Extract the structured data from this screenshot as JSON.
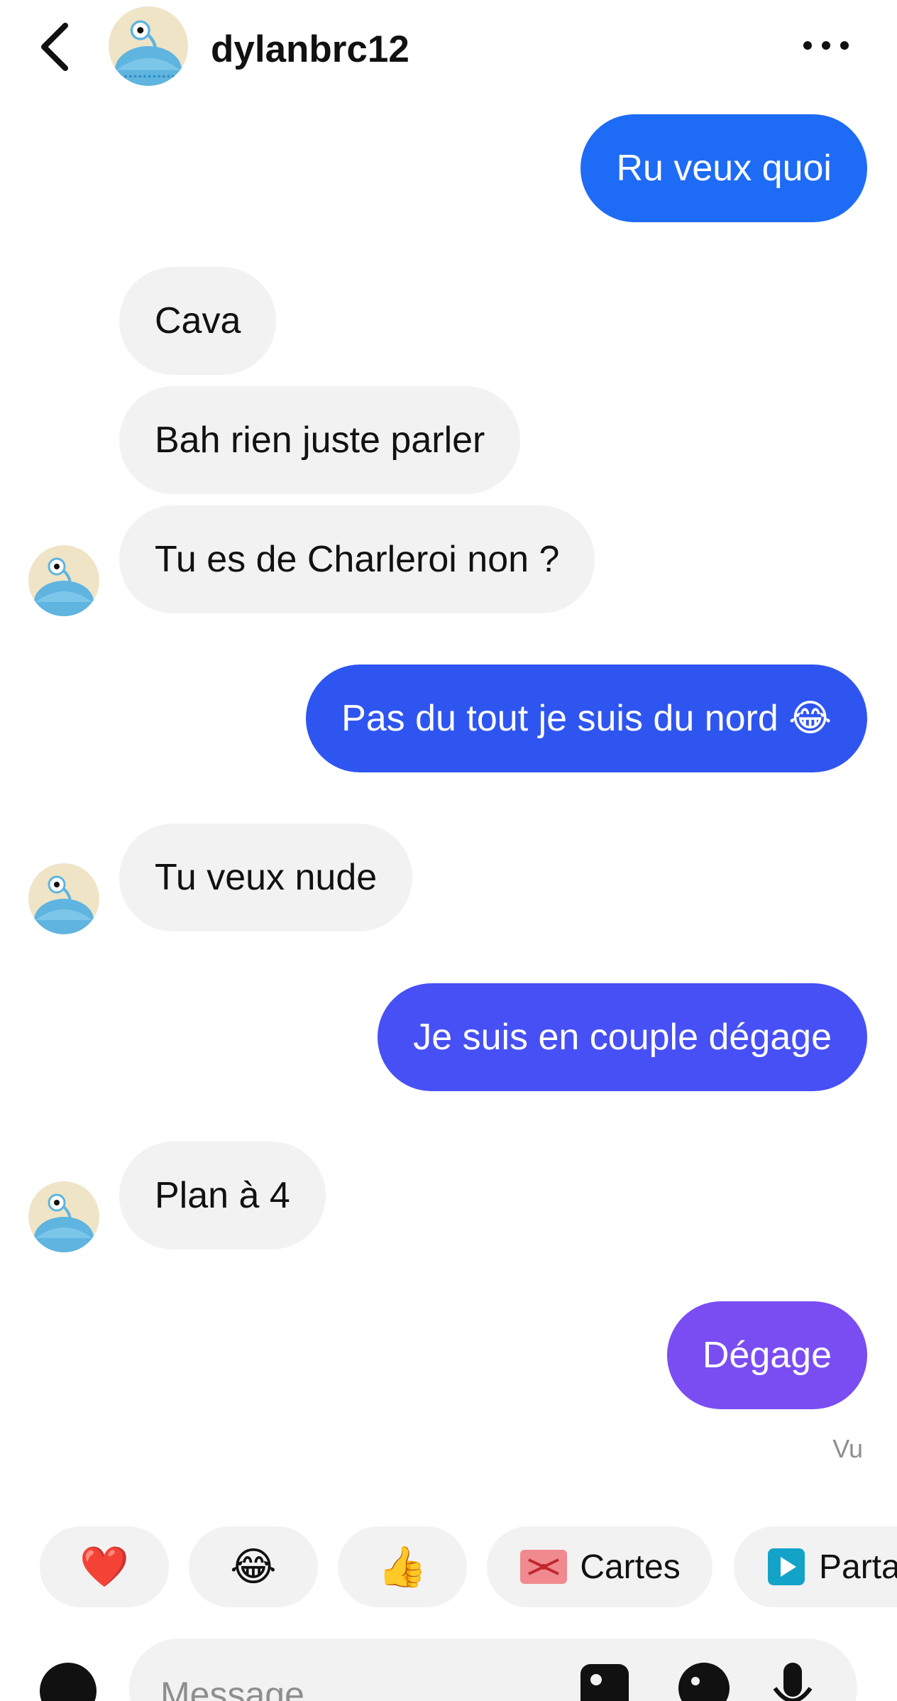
{
  "header": {
    "username": "dylanbrc12"
  },
  "messages": [
    {
      "side": "out",
      "text": "Ru veux quoi",
      "color": "#1e6bf5"
    },
    {
      "side": "in",
      "text": "Cava"
    },
    {
      "side": "in",
      "text": "Bah rien juste parler"
    },
    {
      "side": "in",
      "text": "Tu es de Charleroi non ?"
    },
    {
      "side": "out",
      "text": "Pas du tout je suis du nord 😂",
      "color": "#2f55f0"
    },
    {
      "side": "in",
      "text": "Tu veux nude"
    },
    {
      "side": "out",
      "text": "Je suis en couple dégage",
      "color": "#4750f5"
    },
    {
      "side": "in",
      "text": "Plan à 4"
    },
    {
      "side": "out",
      "text": "Dégage",
      "color": "#7a4df3"
    }
  ],
  "status": {
    "seen": "Vu"
  },
  "quick_replies": {
    "heart": "❤️",
    "laugh": "😂",
    "thumbs": "👍",
    "cards_label": "Cartes",
    "share_label": "Parta"
  },
  "composer": {
    "placeholder": "Message"
  },
  "colors": {
    "incoming_bubble": "#f2f2f3",
    "seen_text": "#8e8e8e"
  }
}
